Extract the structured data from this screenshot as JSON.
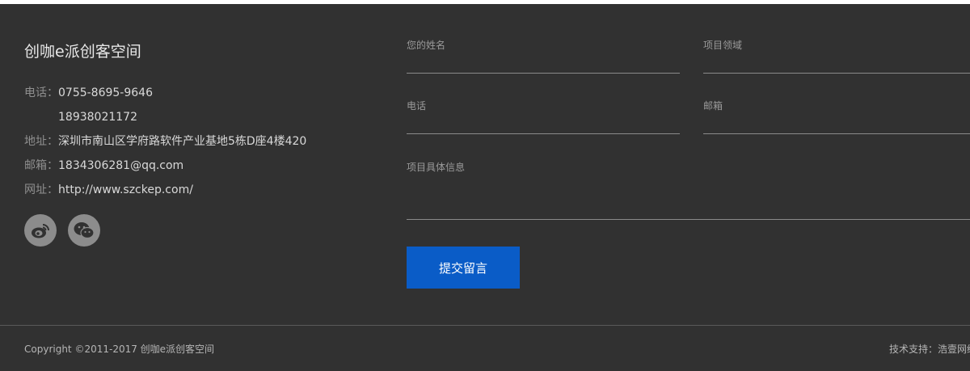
{
  "footer": {
    "brand": "创咖e派创客空间",
    "contact": {
      "phone_label": "电话：",
      "phone_1": "0755-8695-9646",
      "phone_2": "18938021172",
      "address_label": "地址：",
      "address": "深圳市南山区学府路软件产业基地5栋D座4楼420",
      "email_label": "邮箱：",
      "email": "1834306281@qq.com",
      "website_label": "网址：",
      "website": "http://www.szckep.com/"
    },
    "social": [
      "weibo-icon",
      "wechat-icon"
    ]
  },
  "form": {
    "name_label": "您的姓名",
    "field_label": "项目领域",
    "phone_label": "电话",
    "email_label": "邮箱",
    "details_label": "项目具体信息",
    "submit_label": "提交留言"
  },
  "bottom": {
    "copyright": "Copyright ©2011-2017 创咖e派创客空间",
    "support": "技术支持：浩壹网络"
  },
  "colors": {
    "background": "#313131",
    "submit": "#0a5cc7"
  }
}
